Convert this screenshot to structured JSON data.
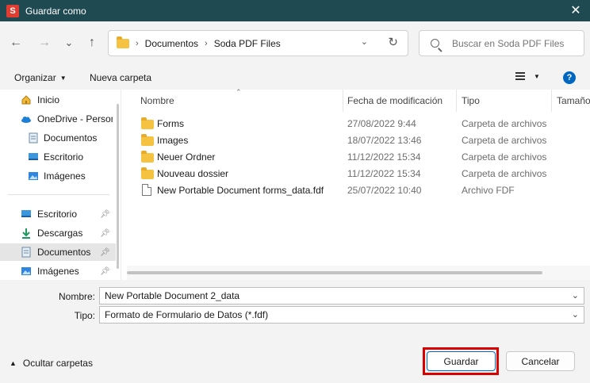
{
  "window": {
    "title": "Guardar como",
    "app_icon_letter": "S",
    "close_glyph": "✕"
  },
  "nav": {
    "back": "←",
    "forward": "→",
    "recent": "⌄",
    "up": "↑",
    "breadcrumb": [
      "Documentos",
      "Soda PDF Files"
    ],
    "separator": "›",
    "search_placeholder": "Buscar en Soda PDF Files"
  },
  "toolbar": {
    "organize_label": "Organizar",
    "new_folder_label": "Nueva carpeta",
    "help_glyph": "?"
  },
  "sidebar": {
    "items": [
      {
        "label": "Inicio",
        "icon": "home-icon",
        "pinned": false
      },
      {
        "label": "OneDrive - Personal",
        "icon": "cloud-icon",
        "pinned": false
      },
      {
        "label": "Documentos",
        "icon": "document-icon",
        "pinned": false
      },
      {
        "label": "Escritorio",
        "icon": "desktop-icon",
        "pinned": false
      },
      {
        "label": "Imágenes",
        "icon": "pictures-icon",
        "pinned": false
      }
    ],
    "quick_access": [
      {
        "label": "Escritorio",
        "icon": "desktop-icon",
        "pinned": true
      },
      {
        "label": "Descargas",
        "icon": "download-icon",
        "pinned": true
      },
      {
        "label": "Documentos",
        "icon": "document-icon",
        "pinned": true,
        "selected": true
      },
      {
        "label": "Imágenes",
        "icon": "pictures-icon",
        "pinned": true
      }
    ]
  },
  "files": {
    "columns": [
      "Nombre",
      "Fecha de modificación",
      "Tipo",
      "Tamaño"
    ],
    "rows": [
      {
        "name": "Forms",
        "date": "27/08/2022 9:44",
        "type": "Carpeta de archivos",
        "icon": "folder-icon"
      },
      {
        "name": "Images",
        "date": "18/07/2022 13:46",
        "type": "Carpeta de archivos",
        "icon": "folder-icon"
      },
      {
        "name": "Neuer Ordner",
        "date": "11/12/2022 15:34",
        "type": "Carpeta de archivos",
        "icon": "folder-icon"
      },
      {
        "name": "Nouveau dossier",
        "date": "11/12/2022 15:34",
        "type": "Carpeta de archivos",
        "icon": "folder-icon"
      },
      {
        "name": "New Portable Document forms_data.fdf",
        "date": "25/07/2022 10:40",
        "type": "Archivo FDF",
        "icon": "file-icon"
      }
    ]
  },
  "form": {
    "name_label": "Nombre:",
    "name_value": "New Portable Document 2_data",
    "type_label": "Tipo:",
    "type_value": "Formato de Formulario de Datos (*.fdf)"
  },
  "footer": {
    "hide_folders_label": "Ocultar carpetas",
    "save_label": "Guardar",
    "cancel_label": "Cancelar"
  },
  "colors": {
    "titlebar": "#1f4a52",
    "accent": "#0067c0",
    "highlight": "#d90000",
    "folder": "#f5c242"
  }
}
